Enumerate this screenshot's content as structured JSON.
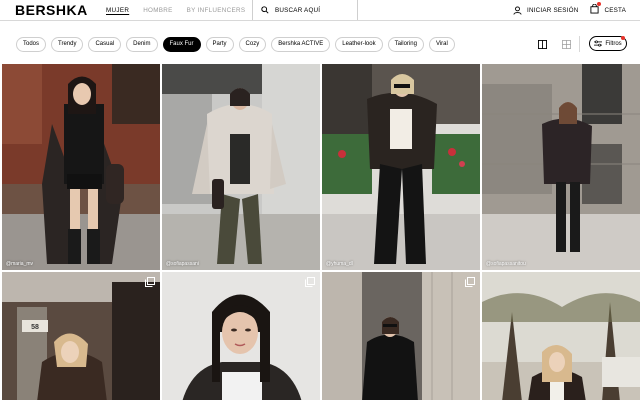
{
  "header": {
    "logo": "BERSHKA",
    "nav": [
      {
        "label": "MUJER",
        "active": true
      },
      {
        "label": "HOMBRE",
        "active": false
      },
      {
        "label": "BY INFLUENCERS",
        "active": false
      }
    ],
    "search_label": "BUSCAR AQUÍ",
    "login_label": "INICIAR SESIÓN",
    "cart_label": "CESTA"
  },
  "chips": [
    {
      "label": "Todos",
      "active": false
    },
    {
      "label": "Trendy",
      "active": false
    },
    {
      "label": "Casual",
      "active": false
    },
    {
      "label": "Denim",
      "active": false
    },
    {
      "label": "Faux Fur",
      "active": true
    },
    {
      "label": "Party",
      "active": false
    },
    {
      "label": "Cozy",
      "active": false
    },
    {
      "label": "Bershka ACTIVE",
      "active": false
    },
    {
      "label": "Leather-look",
      "active": false
    },
    {
      "label": "Tailoring",
      "active": false
    },
    {
      "label": "Viral",
      "active": false
    }
  ],
  "filters_label": "Filtros",
  "tiles": [
    {
      "user": "@maria_mv",
      "multi": false
    },
    {
      "user": "@sofiapassani",
      "multi": false
    },
    {
      "user": "@yhuma_dl",
      "multi": false
    },
    {
      "user": "@sofiapassanitou",
      "multi": false
    },
    {
      "user": "",
      "multi": true
    },
    {
      "user": "",
      "multi": true
    },
    {
      "user": "",
      "multi": true
    },
    {
      "user": "",
      "multi": false
    }
  ],
  "colors": {
    "accent": "#e8332b",
    "active_chip": "#000000"
  }
}
